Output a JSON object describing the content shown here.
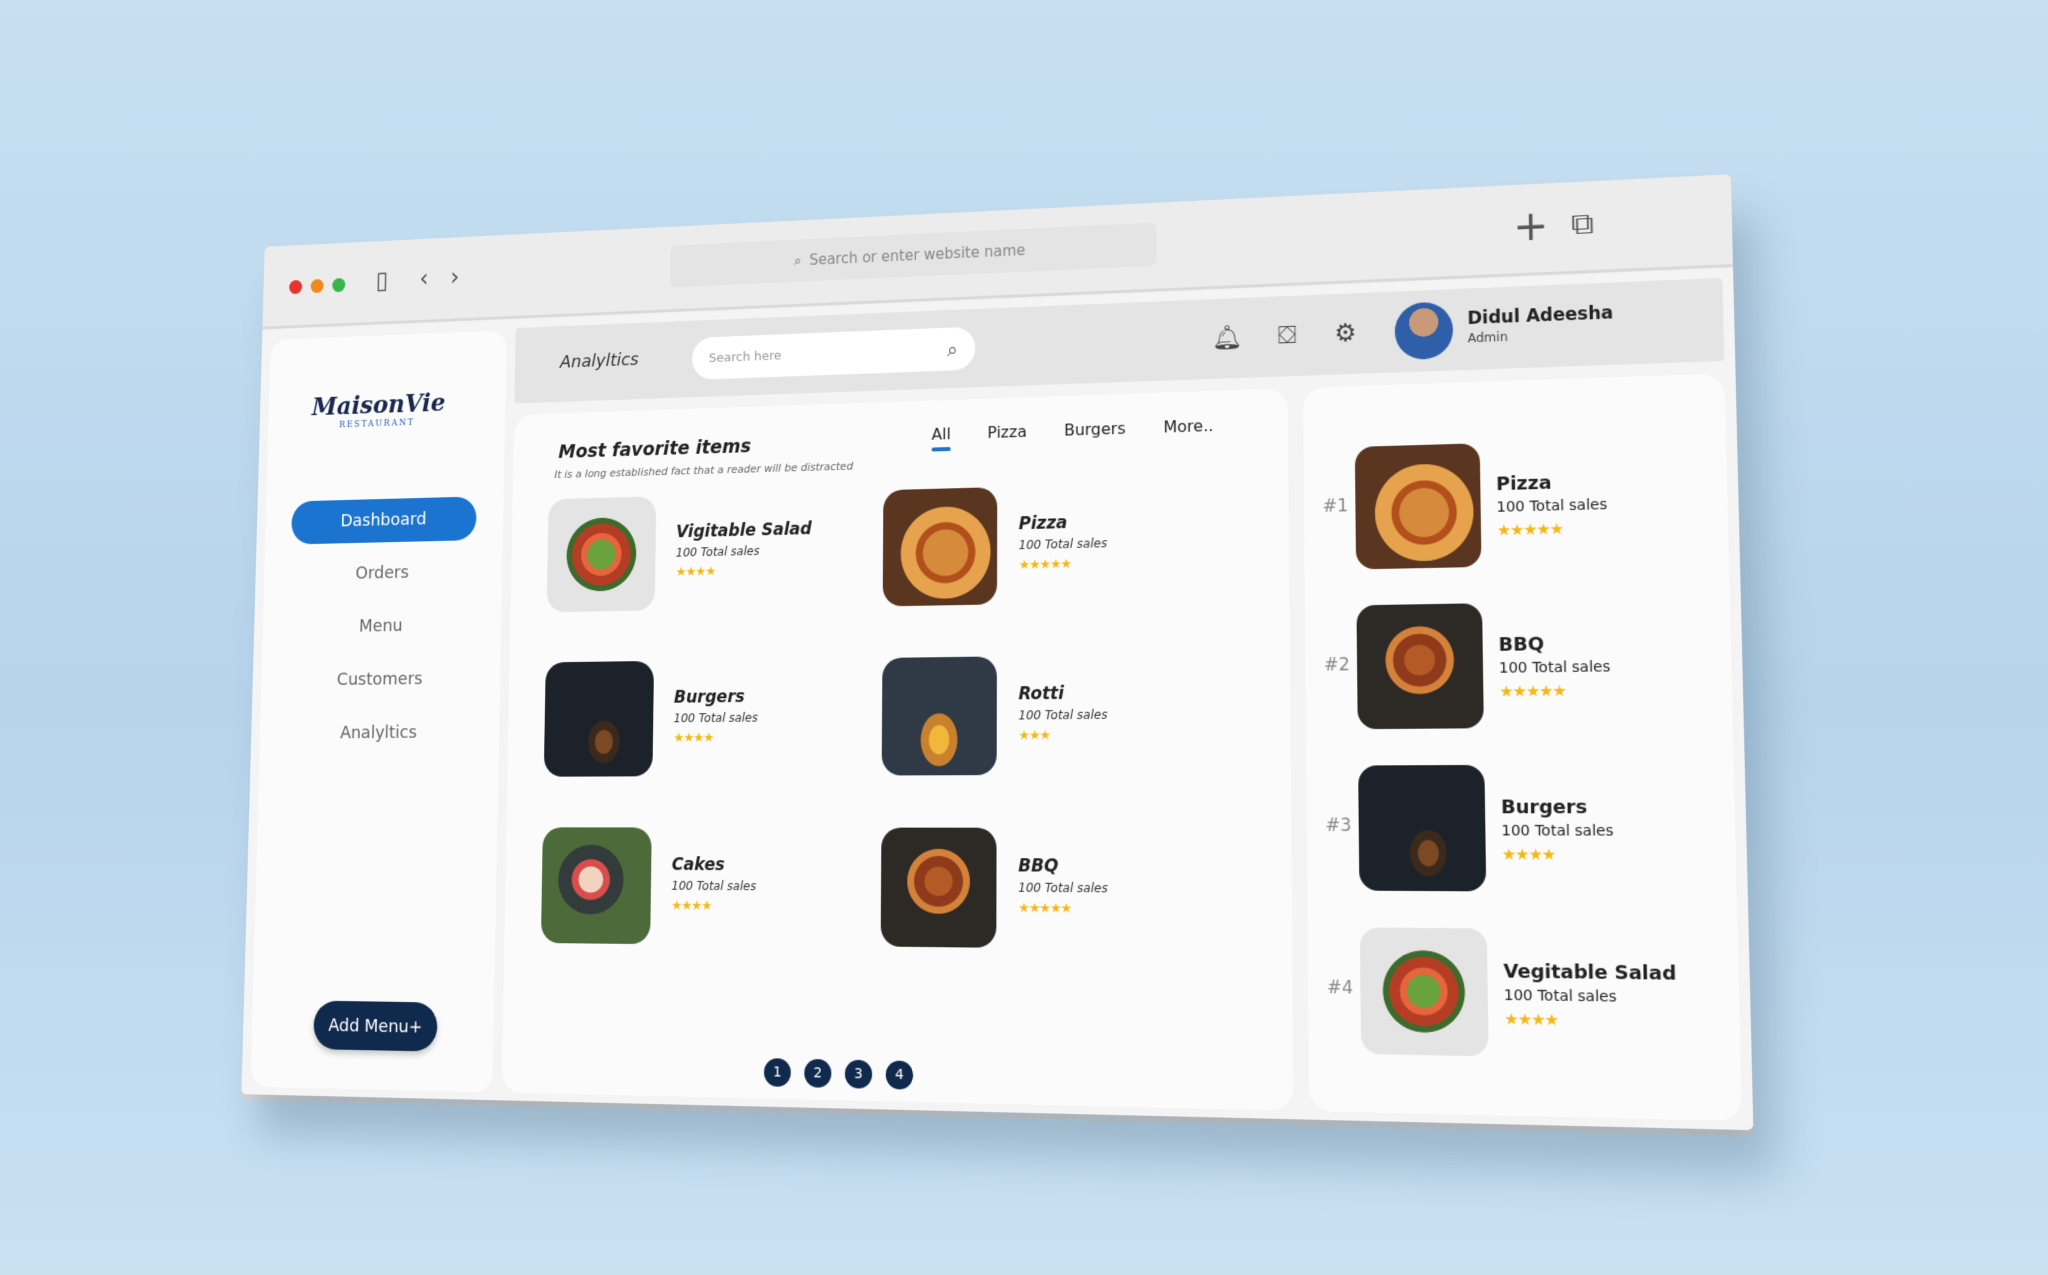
{
  "browser": {
    "url_placeholder": "Search or enter website name"
  },
  "brand": {
    "logo_main": "MaisonVie",
    "logo_sub": "RESTAURANT"
  },
  "sidebar": {
    "items": [
      {
        "label": "Dashboard",
        "active": true
      },
      {
        "label": "Orders",
        "active": false
      },
      {
        "label": "Menu",
        "active": false
      },
      {
        "label": "Customers",
        "active": false
      },
      {
        "label": "Analyltics",
        "active": false
      }
    ],
    "add_button": "Add Menu+"
  },
  "header": {
    "title": "Analyltics",
    "search_placeholder": "Search here",
    "user_name": "Didul Adeesha",
    "user_role": "Admin"
  },
  "favorites": {
    "title": "Most favorite items",
    "subtitle": "It is a long established fact that a reader will be distracted",
    "tabs": [
      {
        "label": "All",
        "active": true
      },
      {
        "label": "Pizza",
        "active": false
      },
      {
        "label": "Burgers",
        "active": false
      },
      {
        "label": "More..",
        "active": false
      }
    ],
    "items": [
      {
        "name": "Vigitable Salad",
        "sales": "100 Total sales",
        "stars": "★★★★",
        "image": "salad"
      },
      {
        "name": "Pizza",
        "sales": "100 Total sales",
        "stars": "★★★★★",
        "image": "pizza"
      },
      {
        "name": "Burgers",
        "sales": "100 Total sales",
        "stars": "★★★★",
        "image": "burger"
      },
      {
        "name": "Rotti",
        "sales": "100 Total sales",
        "stars": "★★★",
        "image": "rotti"
      },
      {
        "name": "Cakes",
        "sales": "100 Total sales",
        "stars": "★★★★",
        "image": "cake"
      },
      {
        "name": "BBQ",
        "sales": "100 Total sales",
        "stars": "★★★★★",
        "image": "bbq"
      }
    ],
    "pages": [
      "1",
      "2",
      "3",
      "4"
    ]
  },
  "ranking": {
    "items": [
      {
        "rank": "#1",
        "name": "Pizza",
        "sales": "100 Total sales",
        "stars": "★★★★★",
        "image": "pizza"
      },
      {
        "rank": "#2",
        "name": "BBQ",
        "sales": "100 Total sales",
        "stars": "★★★★★",
        "image": "bbq"
      },
      {
        "rank": "#3",
        "name": "Burgers",
        "sales": "100 Total sales",
        "stars": "★★★★",
        "image": "burger"
      },
      {
        "rank": "#4",
        "name": "Vegitable Salad",
        "sales": "100 Total sales",
        "stars": "★★★★",
        "image": "salad"
      }
    ]
  },
  "colors": {
    "accent": "#1b74d0",
    "navy": "#0f2a4c",
    "star": "#f3b817"
  }
}
